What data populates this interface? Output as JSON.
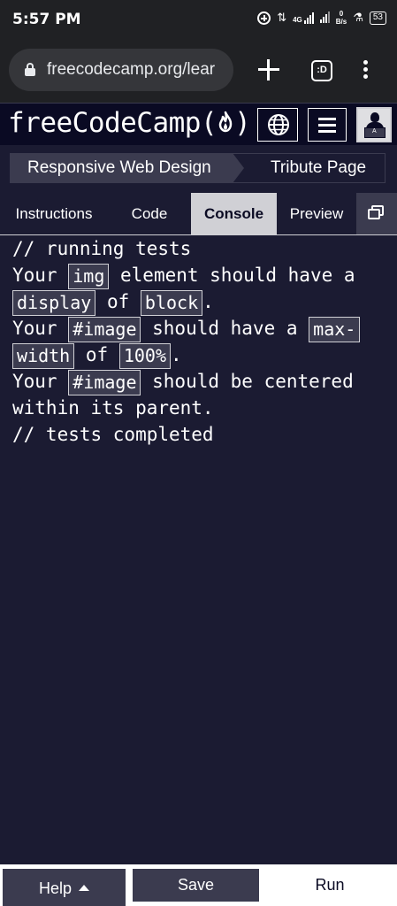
{
  "status_bar": {
    "time": "5:57 PM",
    "network": "4G",
    "speed_value": "0",
    "speed_unit": "B/s",
    "battery": "53"
  },
  "browser": {
    "url": "freecodecamp.org/lear",
    "tab_count": ":D",
    "icons": [
      "lock-icon",
      "plus-icon",
      "tab-switcher-icon",
      "more-vert-icon"
    ]
  },
  "navbar": {
    "logo": "freeCodeCamp(🔥)",
    "logo_text": "freeCodeCamp(",
    "logo_close": ")",
    "icons": [
      "globe-icon",
      "hamburger-icon",
      "avatar"
    ]
  },
  "breadcrumb": {
    "superblock": "Responsive Web Design",
    "block": "Tribute Page"
  },
  "tabs": {
    "instructions": "Instructions",
    "code": "Code",
    "console": "Console",
    "preview": "Preview",
    "active": "Console"
  },
  "console": {
    "running": "// running tests",
    "test1": {
      "p1": "Your",
      "c1": "img",
      "p2": "element should have a",
      "c2": "display",
      "p3": "of",
      "c3": "block",
      "p4": "."
    },
    "test2": {
      "p1": "Your",
      "c1": "#image",
      "p2": "should have a",
      "c2a": "max-",
      "c2b": "width",
      "p3": "of",
      "c3": "100%",
      "p4": "."
    },
    "test3": {
      "p1": "Your",
      "c1": "#image",
      "p2": "should be centered",
      "p3": "within its parent."
    },
    "completed": "// tests completed"
  },
  "actions": {
    "help": "Help",
    "save": "Save",
    "run": "Run"
  },
  "colors": {
    "background": "#1b1b32",
    "navbar": "#0a0a23",
    "secondary": "#3b3b4f",
    "active_tab": "#d0d0d5"
  }
}
